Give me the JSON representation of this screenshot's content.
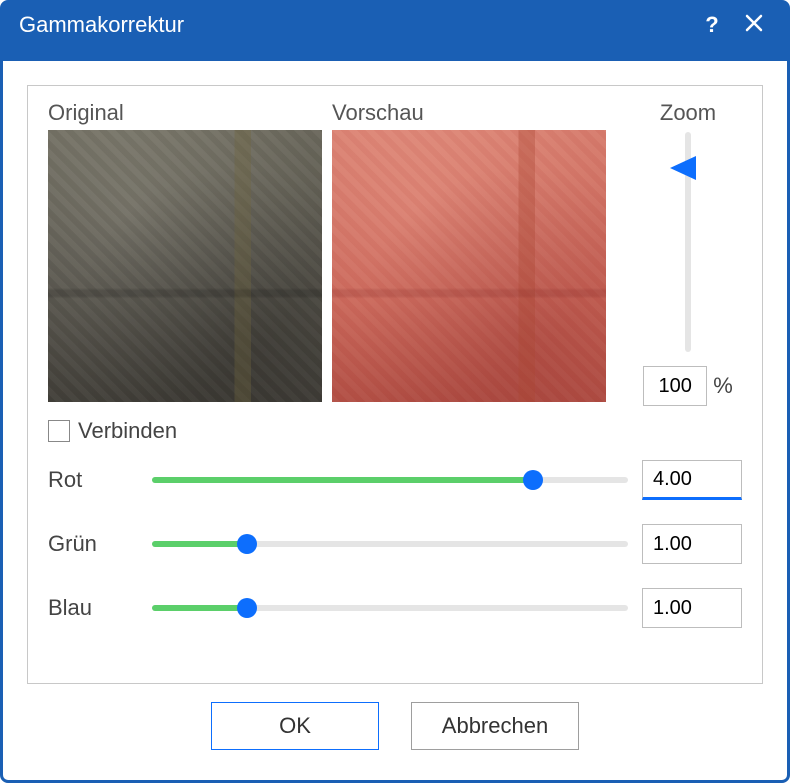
{
  "title": "Gammakorrektur",
  "previews": {
    "original_label": "Original",
    "preview_label": "Vorschau"
  },
  "zoom": {
    "label": "Zoom",
    "value": "100",
    "unit": "%"
  },
  "link": {
    "checked": false,
    "label": "Verbinden"
  },
  "channels": [
    {
      "name": "Rot",
      "value": "4.00",
      "fill_pct": 80,
      "focused": true
    },
    {
      "name": "Grün",
      "value": "1.00",
      "fill_pct": 20,
      "focused": false
    },
    {
      "name": "Blau",
      "value": "1.00",
      "fill_pct": 20,
      "focused": false
    }
  ],
  "buttons": {
    "ok": "OK",
    "cancel": "Abbrechen"
  }
}
